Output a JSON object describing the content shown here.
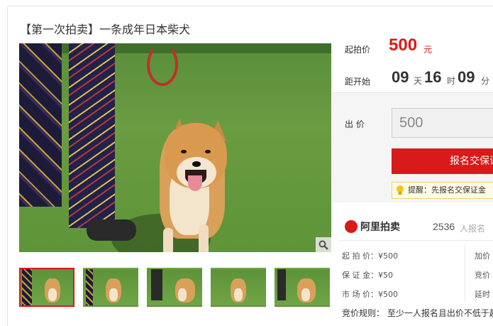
{
  "title": "【第一次拍卖】一条成年日本柴犬",
  "price": {
    "label": "起拍价",
    "value": "500",
    "unit": "元"
  },
  "countdown": {
    "label": "距开始",
    "days": "09",
    "days_unit": "天",
    "hours": "16",
    "hours_unit": "时",
    "minutes": "09",
    "minutes_unit": "分"
  },
  "bid": {
    "label": "出 价",
    "value": "500",
    "button": "报名交保证",
    "tip": "提醒：先报名交保证金"
  },
  "brand": {
    "name": "阿里拍卖",
    "signups": "2536",
    "signups_unit": "人报名"
  },
  "details": {
    "start_price": "起 拍 价：¥500",
    "deposit": "保 证 金：¥50",
    "market_price": "市 场 价：¥500",
    "increment": "加价",
    "cycle": "竞价",
    "delay": "延时"
  },
  "rules": "竞价规则：   至少一人报名且出价不低于起",
  "colors": {
    "accent": "#d91a1a"
  },
  "icons": {
    "zoom": "zoom-icon",
    "tip": "lightbulb-icon",
    "brand": "ali-auction-icon"
  }
}
